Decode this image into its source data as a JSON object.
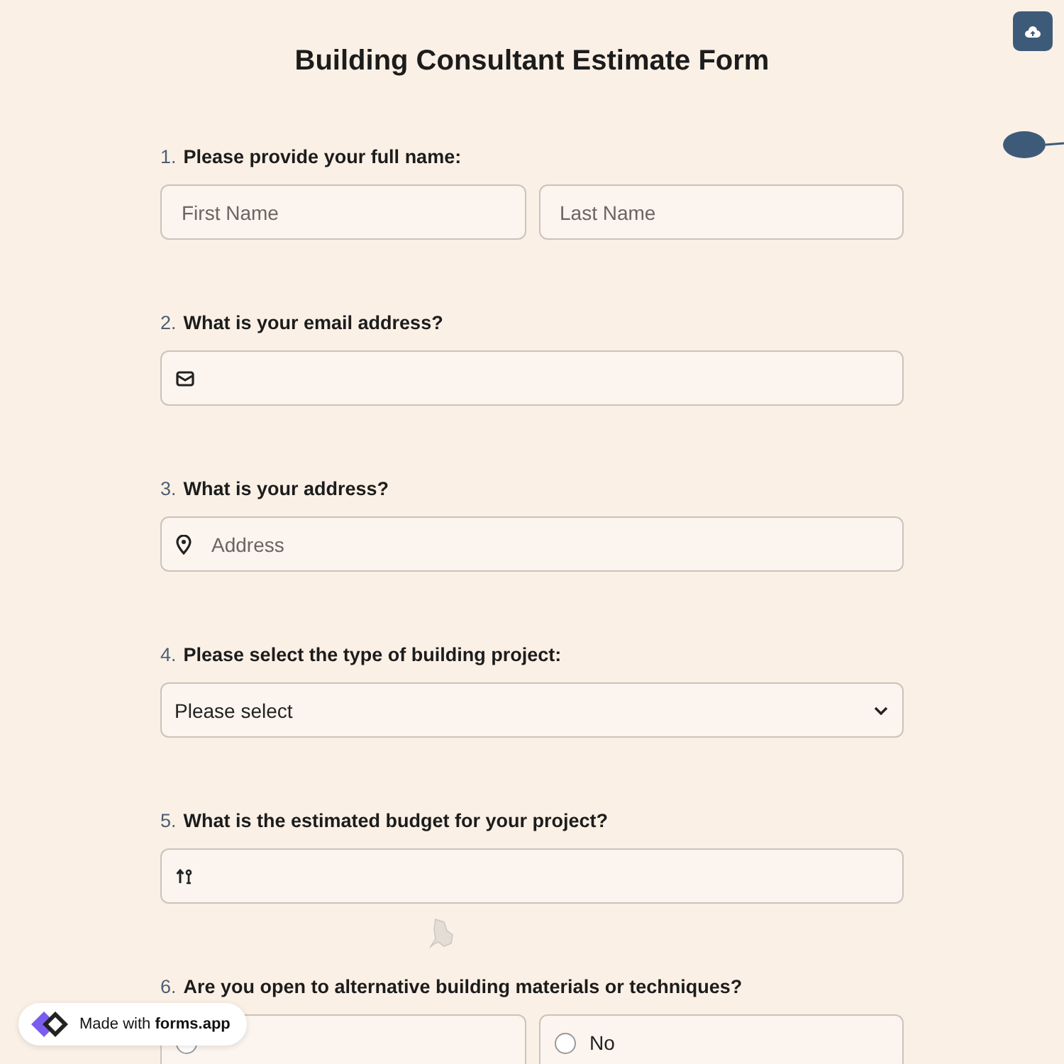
{
  "title": "Building Consultant Estimate Form",
  "questions": [
    {
      "number": "1.",
      "label": "Please provide your full name:",
      "kind": "name",
      "placeholders": [
        "First Name",
        "Last Name"
      ]
    },
    {
      "number": "2.",
      "label": "What is your email address?",
      "kind": "email"
    },
    {
      "number": "3.",
      "label": "What is your address?",
      "kind": "address",
      "placeholder": "Address"
    },
    {
      "number": "4.",
      "label": "Please select the type of building project:",
      "kind": "select",
      "value": "Please select"
    },
    {
      "number": "5.",
      "label": "What is the estimated budget for your project?",
      "kind": "number"
    },
    {
      "number": "6.",
      "label": "Are you open to alternative building materials or techniques?",
      "kind": "radio",
      "options": [
        {
          "selected": false
        },
        {
          "label": "No",
          "selected": false
        }
      ]
    }
  ],
  "badge": "Made with **forms.app**"
}
